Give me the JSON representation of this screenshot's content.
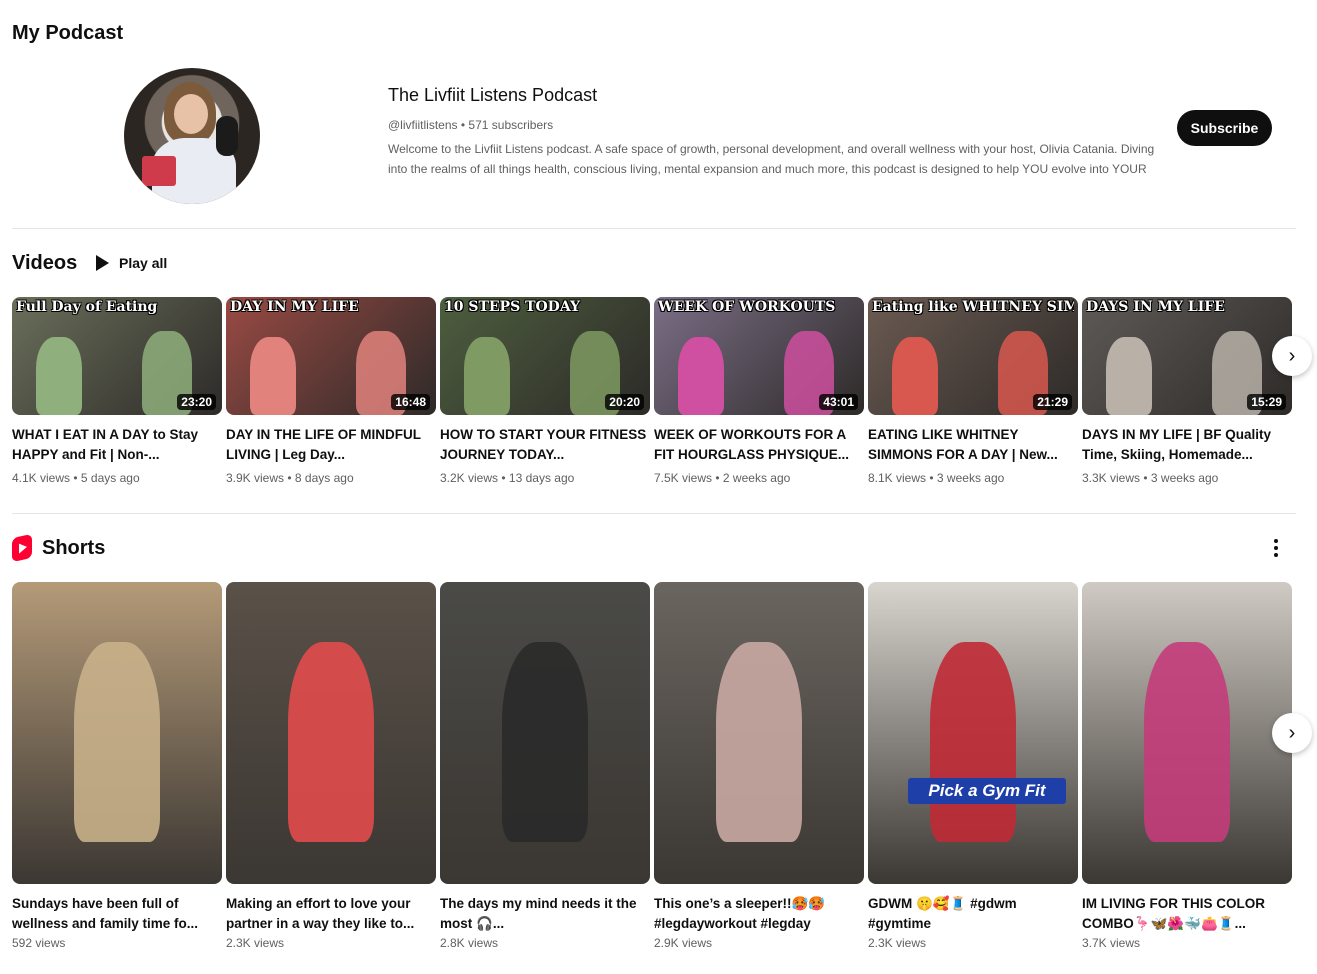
{
  "page": {
    "title": "My Podcast"
  },
  "channel": {
    "name": "The Livfiit Listens Podcast",
    "handle": "@livfiitlistens",
    "separator": "•",
    "subscribers": "571 subscribers",
    "description": "Welcome to the Livfiit Listens podcast. A safe space of growth, personal development, and overall wellness with your host, Olivia Catania. Diving into the realms of all things health, conscious living, mental expansion and much more, this podcast is designed to help YOU evolve into YOUR",
    "subscribe_label": "Subscribe"
  },
  "videos": {
    "heading": "Videos",
    "play_all_label": "Play all",
    "items": [
      {
        "thumb_text": "Full Day of Eating",
        "duration": "23:20",
        "title": "WHAT I EAT IN A DAY to Stay HAPPY and Fit | Non-...",
        "views": "4.1K views",
        "age": "5 days ago",
        "bg": "#6a6f5a",
        "accent": "#8fb07c"
      },
      {
        "thumb_text": "DAY IN MY LIFE",
        "duration": "16:48",
        "title": "DAY IN THE LIFE OF MINDFUL LIVING | Leg Day...",
        "views": "3.9K views",
        "age": "8 days ago",
        "bg": "#9a4a44",
        "accent": "#e2827c"
      },
      {
        "thumb_text": "10 STEPS TODAY",
        "duration": "20:20",
        "title": "HOW TO START YOUR FITNESS JOURNEY TODAY...",
        "views": "3.2K views",
        "age": "13 days ago",
        "bg": "#4d5e3e",
        "accent": "#7f9a62"
      },
      {
        "thumb_text": "WEEK OF WORKOUTS",
        "duration": "43:01",
        "title": "WEEK OF WORKOUTS FOR A FIT HOURGLASS PHYSIQUE...",
        "views": "7.5K views",
        "age": "2 weeks ago",
        "bg": "#7b6e86",
        "accent": "#cf4fa0"
      },
      {
        "thumb_text": "Eating like WHITNEY SIMMONS",
        "duration": "21:29",
        "title": "EATING LIKE WHITNEY SIMMONS FOR A DAY | New...",
        "views": "8.1K views",
        "age": "3 weeks ago",
        "bg": "#6b5b52",
        "accent": "#d8584f"
      },
      {
        "thumb_text": "DAYS IN MY LIFE",
        "duration": "15:29",
        "title": "DAYS IN MY LIFE | BF Quality Time, Skiing, Homemade...",
        "views": "3.3K views",
        "age": "3 weeks ago",
        "bg": "#5e5a58",
        "accent": "#b9b1a8"
      }
    ]
  },
  "shorts": {
    "heading": "Shorts",
    "items": [
      {
        "title": "Sundays have been full of wellness and family time fo...",
        "views": "592 views",
        "bg": "#b49a78",
        "accent": "#c8b08a",
        "overlay": ""
      },
      {
        "title": "Making an effort to love your partner in a way they like to...",
        "views": "2.3K views",
        "bg": "#5a5148",
        "accent": "#e14b4b",
        "overlay": ""
      },
      {
        "title": "The days my mind needs it the most 🎧...",
        "views": "2.8K views",
        "bg": "#4a4a46",
        "accent": "#2a2a2a",
        "overlay": ""
      },
      {
        "title": "This one’s a sleeper!!🥵🥵 #legdayworkout #legday",
        "views": "2.9K views",
        "bg": "#6a655f",
        "accent": "#c9a8a2",
        "overlay": ""
      },
      {
        "title": "GDWM 🤫🥰🧵 #gdwm #gymtime",
        "views": "2.3K views",
        "bg": "#d8d4ce",
        "accent": "#c02a35",
        "overlay": "Pick a Gym Fit"
      },
      {
        "title": "IM LIVING FOR THIS COLOR COMBO🦩🦋🌺🐳👛🧵...",
        "views": "3.7K views",
        "bg": "#cfcac3",
        "accent": "#c43c7a",
        "overlay": ""
      }
    ]
  },
  "icons": {
    "play": "play-icon",
    "next": "chevron-right-icon",
    "shorts": "shorts-logo-icon",
    "more": "more-vert-icon"
  }
}
